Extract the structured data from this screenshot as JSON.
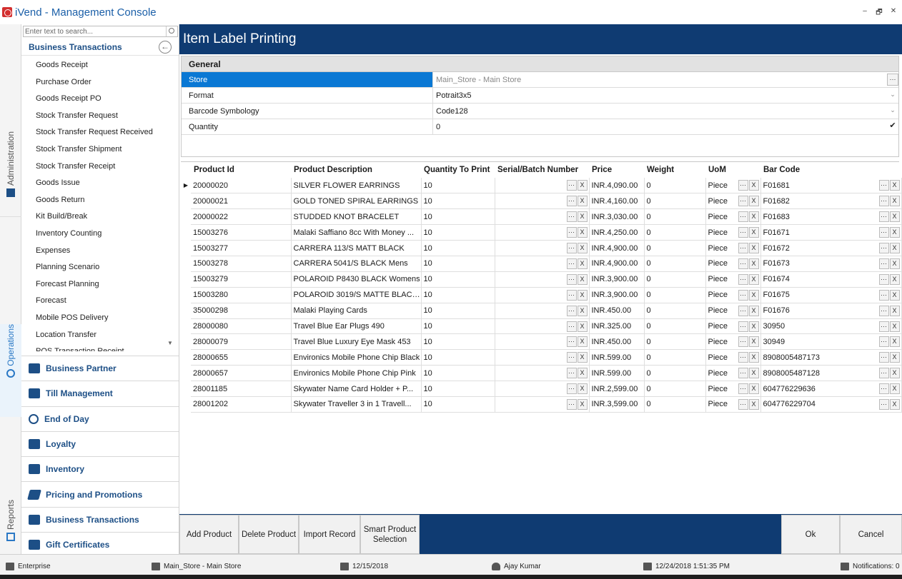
{
  "window": {
    "title": "iVend - Management Console",
    "minimize": "–",
    "restore": "🗗",
    "close": "✕"
  },
  "vtabs": {
    "administration": "Administration",
    "operations": "Operations",
    "reports": "Reports"
  },
  "nav": {
    "search_placeholder": "Enter text to search...",
    "section_title": "Business Transactions",
    "items": [
      "Goods Receipt",
      "Purchase Order",
      "Goods Receipt PO",
      "Stock Transfer Request",
      "Stock Transfer Request Received",
      "Stock Transfer Shipment",
      "Stock Transfer Receipt",
      "Goods Issue",
      "Goods Return",
      "Kit Build/Break",
      "Inventory Counting",
      "Expenses",
      "Planning Scenario",
      "Forecast Planning",
      "Forecast",
      "Mobile POS Delivery",
      "Location Transfer",
      "POS Transaction Receipt"
    ],
    "groups": [
      {
        "label": "Business Partner",
        "icon": "business-partner-icon"
      },
      {
        "label": "Till Management",
        "icon": "till-icon"
      },
      {
        "label": "End of Day",
        "icon": "clock-icon"
      },
      {
        "label": "Loyalty",
        "icon": "gift-icon"
      },
      {
        "label": "Inventory",
        "icon": "warehouse-icon"
      },
      {
        "label": "Pricing and Promotions",
        "icon": "tag-icon"
      },
      {
        "label": "Business Transactions",
        "icon": "transactions-icon"
      },
      {
        "label": "Gift Certificates",
        "icon": "certificate-icon"
      }
    ]
  },
  "page": {
    "title": "Item Label Printing"
  },
  "general": {
    "header": "General",
    "rows": [
      {
        "label": "Store",
        "value": "Main_Store - Main Store"
      },
      {
        "label": "Format",
        "value": "Potrait3x5"
      },
      {
        "label": "Barcode Symbology",
        "value": "Code128"
      },
      {
        "label": "Quantity",
        "value": "0"
      }
    ]
  },
  "grid": {
    "columns": [
      "Product Id",
      "Product Description",
      "Quantity To Print",
      "Serial/Batch Number",
      "Price",
      "Weight",
      "UoM",
      "Bar Code"
    ],
    "rows": [
      {
        "id": "20000020",
        "desc": "SILVER FLOWER EARRINGS",
        "qty": "10",
        "serial": "",
        "price": "INR.4,090.00",
        "weight": "0",
        "uom": "Piece",
        "barcode": "F01681"
      },
      {
        "id": "20000021",
        "desc": "GOLD TONED SPIRAL EARRINGS",
        "qty": "10",
        "serial": "",
        "price": "INR.4,160.00",
        "weight": "0",
        "uom": "Piece",
        "barcode": "F01682"
      },
      {
        "id": "20000022",
        "desc": "STUDDED KNOT BRACELET",
        "qty": "10",
        "serial": "",
        "price": "INR.3,030.00",
        "weight": "0",
        "uom": "Piece",
        "barcode": "F01683"
      },
      {
        "id": "15003276",
        "desc": "Malaki Saffiano 8cc With Money ...",
        "qty": "10",
        "serial": "",
        "price": "INR.4,250.00",
        "weight": "0",
        "uom": "Piece",
        "barcode": "F01671"
      },
      {
        "id": "15003277",
        "desc": "CARRERA 113/S MATT BLACK",
        "qty": "10",
        "serial": "",
        "price": "INR.4,900.00",
        "weight": "0",
        "uom": "Piece",
        "barcode": "F01672"
      },
      {
        "id": "15003278",
        "desc": "CARRERA 5041/S BLACK Mens",
        "qty": "10",
        "serial": "",
        "price": "INR.4,900.00",
        "weight": "0",
        "uom": "Piece",
        "barcode": "F01673"
      },
      {
        "id": "15003279",
        "desc": "POLAROID P8430 BLACK Womens",
        "qty": "10",
        "serial": "",
        "price": "INR.3,900.00",
        "weight": "0",
        "uom": "Piece",
        "barcode": "F01674"
      },
      {
        "id": "15003280",
        "desc": "POLAROID 3019/S MATTE BLACK...",
        "qty": "10",
        "serial": "",
        "price": "INR.3,900.00",
        "weight": "0",
        "uom": "Piece",
        "barcode": "F01675"
      },
      {
        "id": "35000298",
        "desc": "Malaki Playing Cards",
        "qty": "10",
        "serial": "",
        "price": "INR.450.00",
        "weight": "0",
        "uom": "Piece",
        "barcode": "F01676"
      },
      {
        "id": "28000080",
        "desc": "Travel Blue Ear Plugs 490",
        "qty": "10",
        "serial": "",
        "price": "INR.325.00",
        "weight": "0",
        "uom": "Piece",
        "barcode": "30950"
      },
      {
        "id": "28000079",
        "desc": "Travel Blue Luxury Eye Mask 453",
        "qty": "10",
        "serial": "",
        "price": "INR.450.00",
        "weight": "0",
        "uom": "Piece",
        "barcode": "30949"
      },
      {
        "id": "28000655",
        "desc": "Environics Mobile Phone Chip Black",
        "qty": "10",
        "serial": "",
        "price": "INR.599.00",
        "weight": "0",
        "uom": "Piece",
        "barcode": "8908005487173"
      },
      {
        "id": "28000657",
        "desc": "Environics Mobile Phone Chip Pink",
        "qty": "10",
        "serial": "",
        "price": "INR.599.00",
        "weight": "0",
        "uom": "Piece",
        "barcode": "8908005487128"
      },
      {
        "id": "28001185",
        "desc": "Skywater Name Card Holder + P...",
        "qty": "10",
        "serial": "",
        "price": "INR.2,599.00",
        "weight": "0",
        "uom": "Piece",
        "barcode": "604776229636"
      },
      {
        "id": "28001202",
        "desc": "Skywater Traveller 3 in 1 Travell...",
        "qty": "10",
        "serial": "",
        "price": "INR.3,599.00",
        "weight": "0",
        "uom": "Piece",
        "barcode": "604776229704"
      }
    ],
    "btn_dots": "···",
    "btn_x": "X",
    "current_row_marker": "▶"
  },
  "actions": {
    "add_product": "Add Product",
    "delete_product": "Delete Product",
    "import_record": "Import Record",
    "smart_product_line1": "Smart Product",
    "smart_product_line2": "Selection",
    "ok": "Ok",
    "cancel": "Cancel"
  },
  "status": {
    "edition": "Enterprise",
    "store": "Main_Store - Main Store",
    "date": "12/15/2018",
    "user": "Ajay Kumar",
    "login_time": "12/24/2018 1:51:35 PM",
    "notifications": "Notifications: 0"
  },
  "colors": {
    "header_blue": "#0f3b72",
    "selected_blue": "#0a78d4",
    "nav_text_blue": "#1d4f86",
    "title_blue": "#1b5fa8"
  }
}
